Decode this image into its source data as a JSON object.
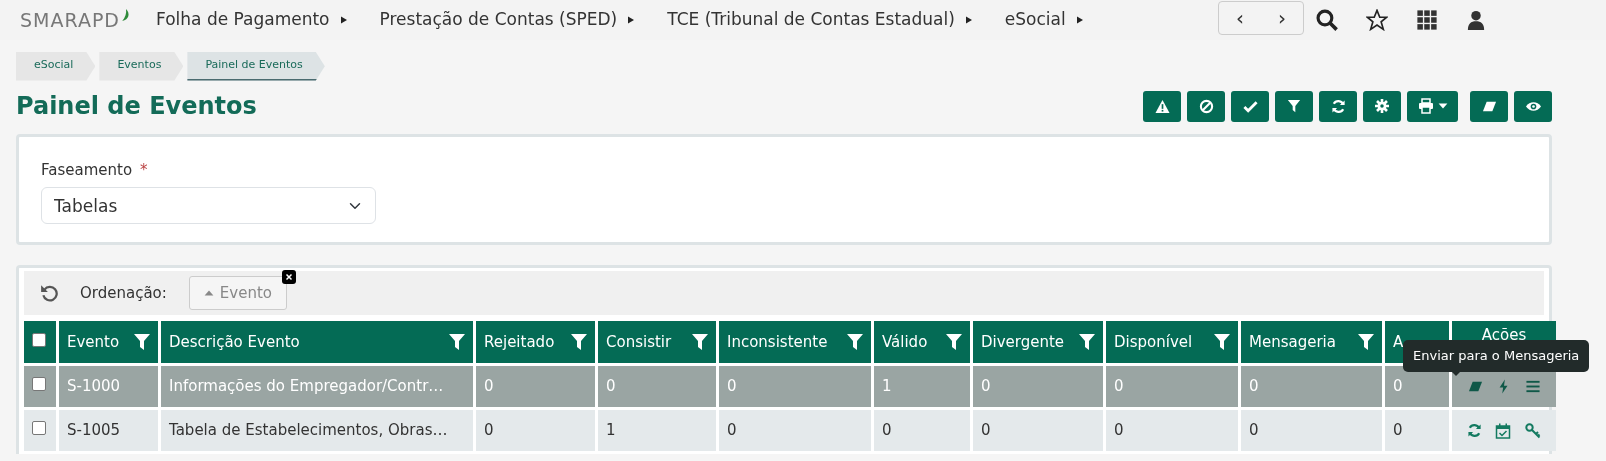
{
  "brand": {
    "name": "SMARAPD"
  },
  "menu": [
    {
      "label": "Folha de Pagamento"
    },
    {
      "label": "Prestação de Contas (SPED)"
    },
    {
      "label": "TCE (Tribunal de Contas Estadual)"
    },
    {
      "label": "eSocial"
    }
  ],
  "nav_arrows": [
    "‹",
    "›"
  ],
  "breadcrumb": [
    {
      "label": "eSocial",
      "selected": false
    },
    {
      "label": "Eventos",
      "selected": false
    },
    {
      "label": "Painel de Eventos",
      "selected": true
    }
  ],
  "title": "Painel de Eventos",
  "toolbar": [
    {
      "kind": "warning"
    },
    {
      "kind": "ban"
    },
    {
      "kind": "check"
    },
    {
      "kind": "filter"
    },
    {
      "kind": "refresh"
    },
    {
      "kind": "gear"
    },
    {
      "kind": "print-dropdown"
    },
    {
      "kind": "eraser"
    },
    {
      "kind": "eye"
    }
  ],
  "filter": {
    "label": "Faseamento",
    "required_mark": "*",
    "value": "Tabelas"
  },
  "sorting": {
    "label": "Ordenação:",
    "chip": "Evento"
  },
  "table": {
    "select_all": {
      "checked": false
    },
    "columns": [
      {
        "label": "Evento",
        "filter": true
      },
      {
        "label": "Descrição Evento",
        "filter": true
      },
      {
        "label": "Rejeitado",
        "filter": true
      },
      {
        "label": "Consistir",
        "filter": true
      },
      {
        "label": "Inconsistente",
        "filter": true
      },
      {
        "label": "Válido",
        "filter": true
      },
      {
        "label": "Divergente",
        "filter": true
      },
      {
        "label": "Disponível",
        "filter": true
      },
      {
        "label": "Mensageria",
        "filter": true
      },
      {
        "label": "A",
        "filter": false
      },
      {
        "label": "Ações",
        "filter": false
      }
    ],
    "rows": [
      {
        "selected": true,
        "checked": false,
        "cells": [
          "S-1000",
          "Informações do Empregador/Contr…",
          "0",
          "0",
          "0",
          "1",
          "0",
          "0",
          "0",
          "0"
        ],
        "actions": [
          {
            "kind": "eraser"
          },
          {
            "kind": "bolt"
          },
          {
            "kind": "menu"
          }
        ]
      },
      {
        "selected": false,
        "checked": false,
        "cells": [
          "S-1005",
          "Tabela de Estabelecimentos, Obras…",
          "0",
          "1",
          "0",
          "0",
          "0",
          "0",
          "0",
          "0"
        ],
        "actions": [
          {
            "kind": "refresh"
          },
          {
            "kind": "calendar"
          },
          {
            "kind": "key"
          }
        ]
      }
    ]
  },
  "tooltip": "Enviar para o Mensageria"
}
